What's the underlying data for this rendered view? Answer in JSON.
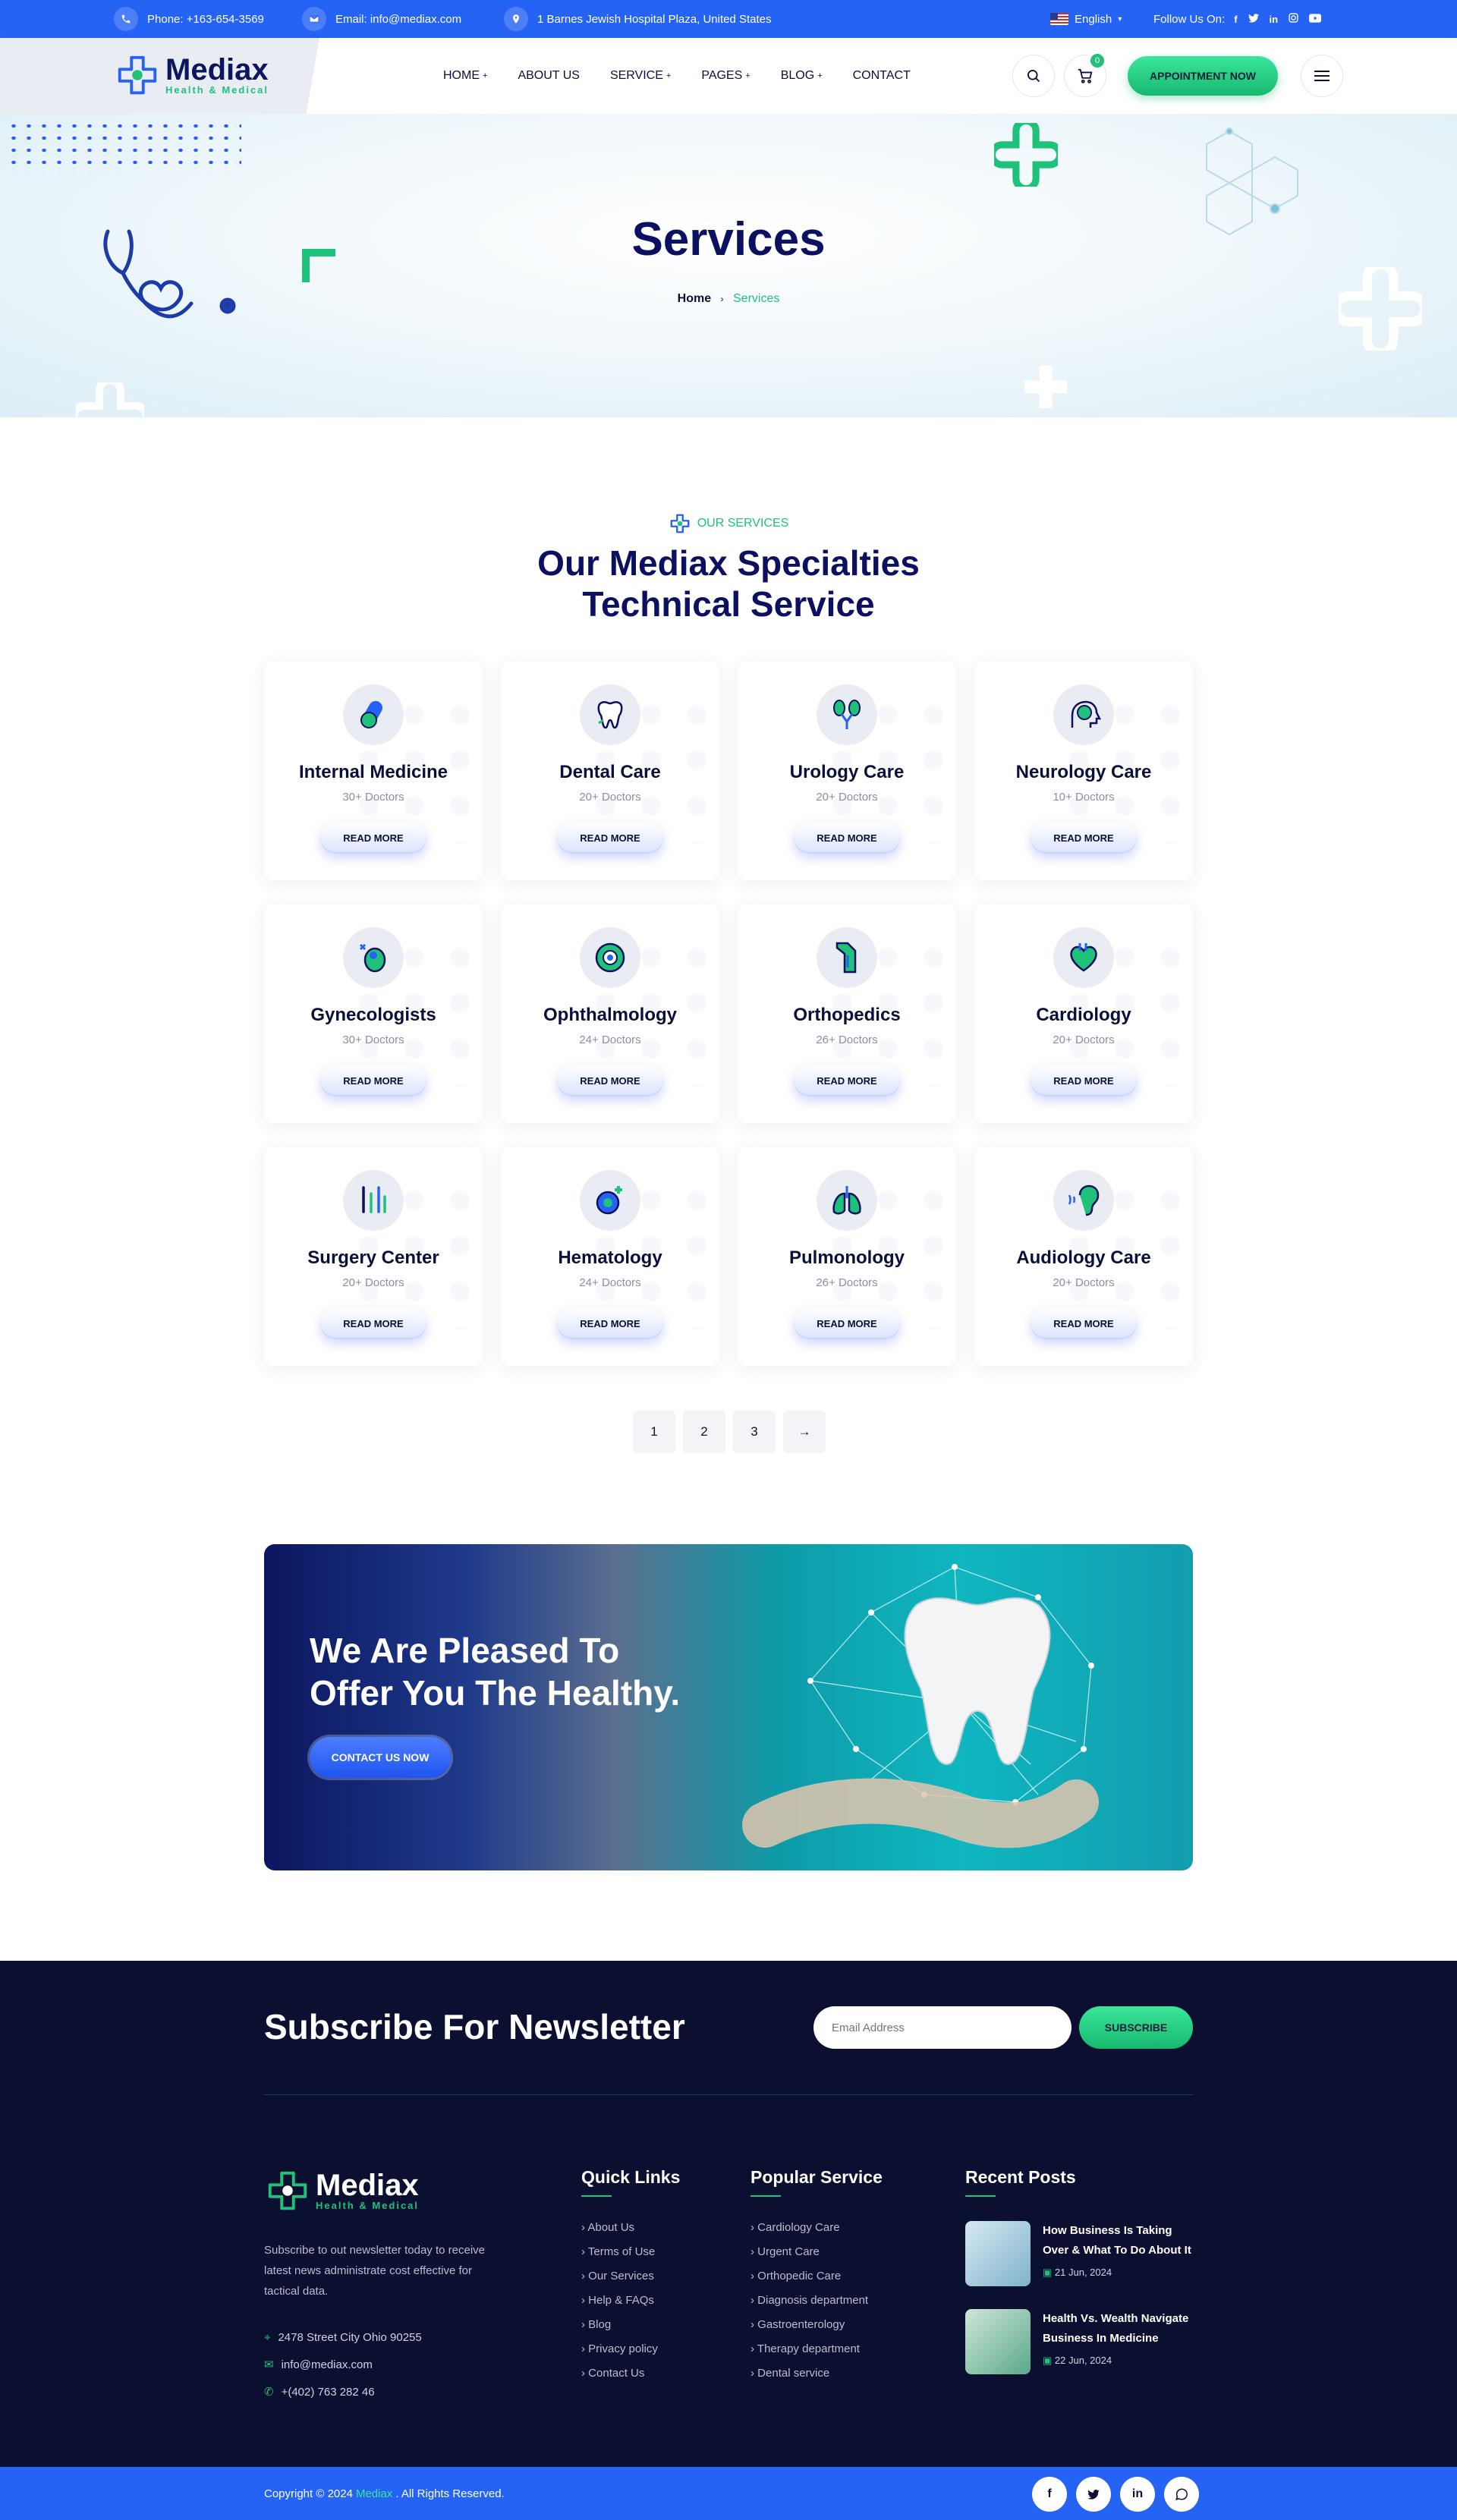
{
  "topbar": {
    "phone": "Phone: +163-654-3569",
    "email": "Email: info@mediax.com",
    "address": "1 Barnes Jewish Hospital Plaza, United States",
    "language": "English",
    "follow": "Follow Us On:",
    "social_icons": [
      "facebook-icon",
      "twitter-icon",
      "linkedin-icon",
      "instagram-icon",
      "youtube-icon"
    ]
  },
  "header": {
    "logo_name": "Mediax",
    "logo_tag": "Health & Medical",
    "nav": [
      {
        "label": "HOME",
        "dropdown": true
      },
      {
        "label": "ABOUT US",
        "dropdown": false
      },
      {
        "label": "SERVICE",
        "dropdown": true
      },
      {
        "label": "PAGES",
        "dropdown": true
      },
      {
        "label": "BLOG",
        "dropdown": true
      },
      {
        "label": "CONTACT",
        "dropdown": false
      }
    ],
    "cart_count": "0",
    "appointment": "APPOINTMENT NOW"
  },
  "hero": {
    "title": "Services",
    "crumb_home": "Home",
    "crumb_current": "Services"
  },
  "services": {
    "subtitle": "OUR SERVICES",
    "title_line1": "Our Mediax Specialties",
    "title_line2": "Technical Service",
    "items": [
      {
        "title": "Internal Medicine",
        "doctors": "30+ Doctors",
        "icon": "pills-icon",
        "button": "READ MORE"
      },
      {
        "title": "Dental Care",
        "doctors": "20+ Doctors",
        "icon": "tooth-icon",
        "button": "READ MORE"
      },
      {
        "title": "Urology Care",
        "doctors": "20+ Doctors",
        "icon": "kidney-icon",
        "button": "READ MORE"
      },
      {
        "title": "Neurology Care",
        "doctors": "10+ Doctors",
        "icon": "brain-icon",
        "button": "READ MORE"
      },
      {
        "title": "Gynecologists",
        "doctors": "30+ Doctors",
        "icon": "fetus-icon",
        "button": "READ MORE"
      },
      {
        "title": "Ophthalmology",
        "doctors": "24+ Doctors",
        "icon": "eye-icon",
        "button": "READ MORE"
      },
      {
        "title": "Orthopedics",
        "doctors": "26+ Doctors",
        "icon": "bone-icon",
        "button": "READ MORE"
      },
      {
        "title": "Cardiology",
        "doctors": "20+ Doctors",
        "icon": "heart-icon",
        "button": "READ MORE"
      },
      {
        "title": "Surgery Center",
        "doctors": "20+ Doctors",
        "icon": "surgery-tools-icon",
        "button": "READ MORE"
      },
      {
        "title": "Hematology",
        "doctors": "24+ Doctors",
        "icon": "blood-cell-icon",
        "button": "READ MORE"
      },
      {
        "title": "Pulmonology",
        "doctors": "26+ Doctors",
        "icon": "lungs-icon",
        "button": "READ MORE"
      },
      {
        "title": "Audiology Care",
        "doctors": "20+ Doctors",
        "icon": "ear-icon",
        "button": "READ MORE"
      }
    ]
  },
  "pagination": {
    "pages": [
      "1",
      "2",
      "3"
    ],
    "next": "→"
  },
  "cta": {
    "line1": "We Are Pleased To",
    "line2": "Offer You The Healthy.",
    "button": "CONTACT US NOW"
  },
  "footer": {
    "newsletter_title": "Subscribe For Newsletter",
    "email_placeholder": "Email Address",
    "subscribe": "SUBSCRIBE",
    "logo_name": "Mediax",
    "logo_tag": "Health & Medical",
    "description": "Subscribe to out newsletter today to receive latest news administrate cost effective for tactical data.",
    "address": "2478 Street City Ohio 90255",
    "email": "info@mediax.com",
    "phone": "+(402) 763 282 46",
    "quick_links_title": "Quick Links",
    "quick_links": [
      "About Us",
      "Terms of Use",
      "Our Services",
      "Help & FAQs",
      "Blog",
      "Privacy policy",
      "Contact Us"
    ],
    "popular_title": "Popular Service",
    "popular": [
      "Cardiology Care",
      "Urgent Care",
      "Orthopedic Care",
      "Diagnosis department",
      "Gastroenterology",
      "Therapy department",
      "Dental service"
    ],
    "recent_title": "Recent Posts",
    "posts": [
      {
        "title": "How Business Is Taking Over & What To Do About It",
        "date": "21 Jun, 2024"
      },
      {
        "title": "Health Vs. Wealth Navigate Business In Medicine",
        "date": "22 Jun, 2024"
      }
    ]
  },
  "copyright": {
    "prefix": "Copyright © 2024",
    "brand": "Mediax",
    "suffix": ". All Rights Reserved."
  },
  "colors": {
    "primary": "#2563f4",
    "accent": "#1fc17b",
    "navy": "#0b1060",
    "footer_bg": "#0b1030"
  }
}
